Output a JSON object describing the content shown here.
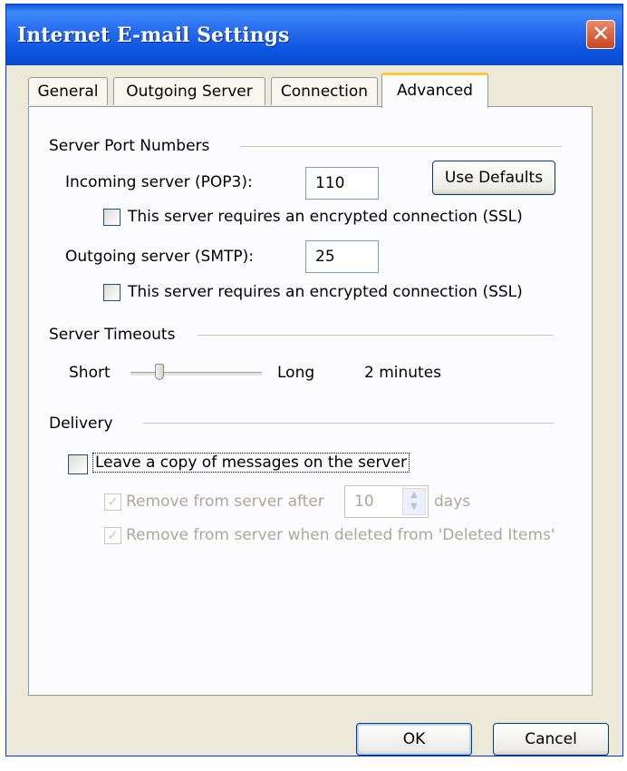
{
  "window": {
    "title": "Internet E-mail Settings",
    "close_glyph": "✕"
  },
  "tabs": [
    "General",
    "Outgoing Server",
    "Connection",
    "Advanced"
  ],
  "active_tab": "Advanced",
  "ports": {
    "group_label": "Server Port Numbers",
    "incoming_label": "Incoming server (POP3):",
    "incoming_value": "110",
    "incoming_ssl_label": "This server requires an encrypted connection (SSL)",
    "incoming_ssl_checked": false,
    "outgoing_label": "Outgoing server (SMTP):",
    "outgoing_value": "25",
    "outgoing_ssl_label": "This server requires an encrypted connection (SSL)",
    "outgoing_ssl_checked": false,
    "use_defaults_label": "Use Defaults"
  },
  "timeouts": {
    "group_label": "Server Timeouts",
    "short_label": "Short",
    "long_label": "Long",
    "value_text": "2 minutes",
    "slider_position": 0.2
  },
  "delivery": {
    "group_label": "Delivery",
    "leave_copy_label": "Leave a copy of messages on the server",
    "leave_copy_checked": false,
    "remove_after_label": "Remove from server after",
    "remove_after_days": "10",
    "days_label": "days",
    "remove_after_checked": true,
    "remove_deleted_label": "Remove from server when deleted from 'Deleted Items'",
    "remove_deleted_checked": true
  },
  "buttons": {
    "ok": "OK",
    "cancel": "Cancel"
  },
  "colors": {
    "title_bar": "#2a6ef0",
    "dialog_bg": "#ece9d8",
    "panel_bg": "#fcfcfe",
    "tab_highlight": "#ffc83c"
  }
}
